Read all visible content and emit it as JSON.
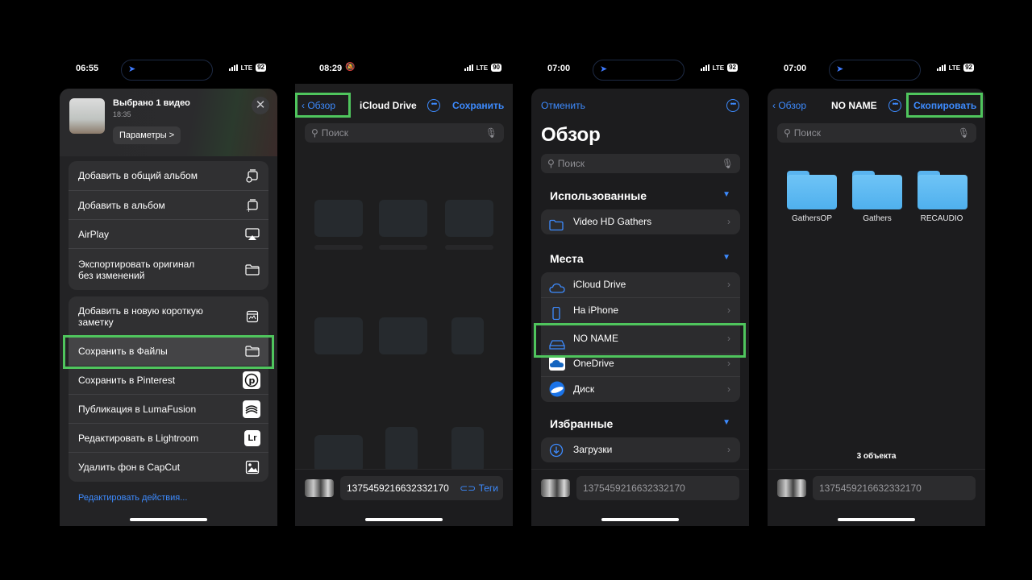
{
  "phones": [
    {
      "status": {
        "time": "06:55",
        "carrier": "LTE",
        "battery": "92"
      },
      "share": {
        "title": "Выбрано 1 видео",
        "time": "18:35",
        "params_label": "Параметры",
        "params_chevron": ">",
        "close_glyph": "✕",
        "group1": [
          {
            "label": "Добавить в общий альбом",
            "icon": "shared-album-icon"
          },
          {
            "label": "Добавить в альбом",
            "icon": "album-icon"
          },
          {
            "label": "AirPlay",
            "icon": "airplay-icon"
          },
          {
            "label": "Экспортировать оригинал без изменений",
            "icon": "folder-icon"
          }
        ],
        "group2": [
          {
            "label": "Добавить в новую короткую заметку",
            "icon": "quick-note-icon"
          },
          {
            "label": "Сохранить в Файлы",
            "icon": "folder-icon"
          },
          {
            "label": "Сохранить в Pinterest",
            "icon": "pinterest-icon"
          },
          {
            "label": "Публикация в LumaFusion",
            "icon": "lumafusion-icon"
          },
          {
            "label": "Редактировать в Lightroom",
            "icon": "lightroom-icon",
            "glyph": "Lr"
          },
          {
            "label": "Удалить фон в CapCut",
            "icon": "image-icon"
          }
        ],
        "edit_actions": "Редактировать действия..."
      }
    },
    {
      "status": {
        "time": "08:29",
        "carrier": "LTE",
        "battery": "90"
      },
      "nav": {
        "back": "Обзор",
        "title": "iCloud Drive",
        "action": "Сохранить",
        "more_glyph": "•••"
      },
      "search_placeholder": "Поиск",
      "file": {
        "name": "1375459216632332170",
        "tags": "Теги"
      }
    },
    {
      "status": {
        "time": "07:00",
        "carrier": "LTE",
        "battery": "92"
      },
      "nav": {
        "cancel": "Отменить",
        "more_glyph": "•••"
      },
      "title": "Обзор",
      "search_placeholder": "Поиск",
      "sections": [
        {
          "title": "Использованные",
          "rows": [
            {
              "label": "Video HD Gathers",
              "icon": "folder-outline-icon"
            }
          ]
        },
        {
          "title": "Места",
          "rows": [
            {
              "label": "iCloud Drive",
              "icon": "icloud-icon"
            },
            {
              "label": "На iPhone",
              "icon": "iphone-icon"
            },
            {
              "label": "NO NAME",
              "icon": "drive-icon"
            },
            {
              "label": "OneDrive",
              "icon": "onedrive-icon"
            },
            {
              "label": "Диск",
              "icon": "yandex-disk-icon"
            }
          ]
        },
        {
          "title": "Избранные",
          "rows": [
            {
              "label": "Загрузки",
              "icon": "downloads-icon"
            }
          ]
        }
      ],
      "file": {
        "name": "1375459216632332170"
      }
    },
    {
      "status": {
        "time": "07:00",
        "carrier": "LTE",
        "battery": "92"
      },
      "nav": {
        "back": "Обзор",
        "title": "NO NAME",
        "action": "Скопировать",
        "more_glyph": "•••"
      },
      "search_placeholder": "Поиск",
      "folders": [
        "GathersOP",
        "Gathers",
        "RECAUDIO"
      ],
      "count": "3 объекта",
      "file": {
        "name": "1375459216632332170"
      }
    }
  ],
  "colors": {
    "accent": "#3d8bff",
    "highlight": "#4fc55d",
    "folder": "#5ab4ef"
  }
}
